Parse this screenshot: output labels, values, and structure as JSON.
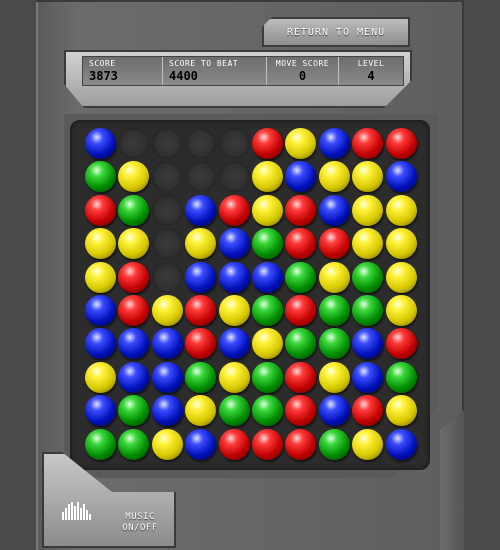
{
  "menu": {
    "return_label": "RETURN TO MENU"
  },
  "score": {
    "score_label": "SCORE",
    "score_value": "3873",
    "beat_label": "SCORE TO BEAT",
    "beat_value": "4400",
    "move_label": "MOVE SCORE",
    "move_value": "0",
    "level_label": "LEVEL",
    "level_value": "4"
  },
  "music": {
    "line1": "MUSIC",
    "line2": "ON/OFF",
    "icon": "equalizer-icon"
  },
  "colors": {
    "red": "#d01010",
    "green": "#10a010",
    "blue": "#1020d0",
    "yellow": "#e8dc10",
    "empty": "#333333"
  },
  "board": [
    [
      "blue",
      "empty",
      "empty",
      "empty",
      "empty",
      "red",
      "yellow",
      "blue",
      "red",
      "red"
    ],
    [
      "green",
      "yellow",
      "empty",
      "empty",
      "empty",
      "yellow",
      "blue",
      "yellow",
      "yellow",
      "blue"
    ],
    [
      "red",
      "green",
      "empty",
      "blue",
      "red",
      "yellow",
      "red",
      "blue",
      "yellow",
      "yellow"
    ],
    [
      "yellow",
      "yellow",
      "empty",
      "yellow",
      "blue",
      "green",
      "red",
      "red",
      "yellow",
      "yellow"
    ],
    [
      "yellow",
      "red",
      "empty",
      "blue",
      "blue",
      "blue",
      "green",
      "yellow",
      "green",
      "yellow"
    ],
    [
      "blue",
      "red",
      "yellow",
      "red",
      "yellow",
      "green",
      "red",
      "green",
      "green",
      "yellow"
    ],
    [
      "blue",
      "blue",
      "blue",
      "red",
      "blue",
      "yellow",
      "green",
      "green",
      "blue",
      "red"
    ],
    [
      "yellow",
      "blue",
      "blue",
      "green",
      "yellow",
      "green",
      "red",
      "yellow",
      "blue",
      "green"
    ],
    [
      "blue",
      "green",
      "blue",
      "yellow",
      "green",
      "green",
      "red",
      "blue",
      "red",
      "yellow"
    ],
    [
      "green",
      "green",
      "yellow",
      "blue",
      "red",
      "red",
      "red",
      "green",
      "yellow",
      "blue"
    ]
  ]
}
